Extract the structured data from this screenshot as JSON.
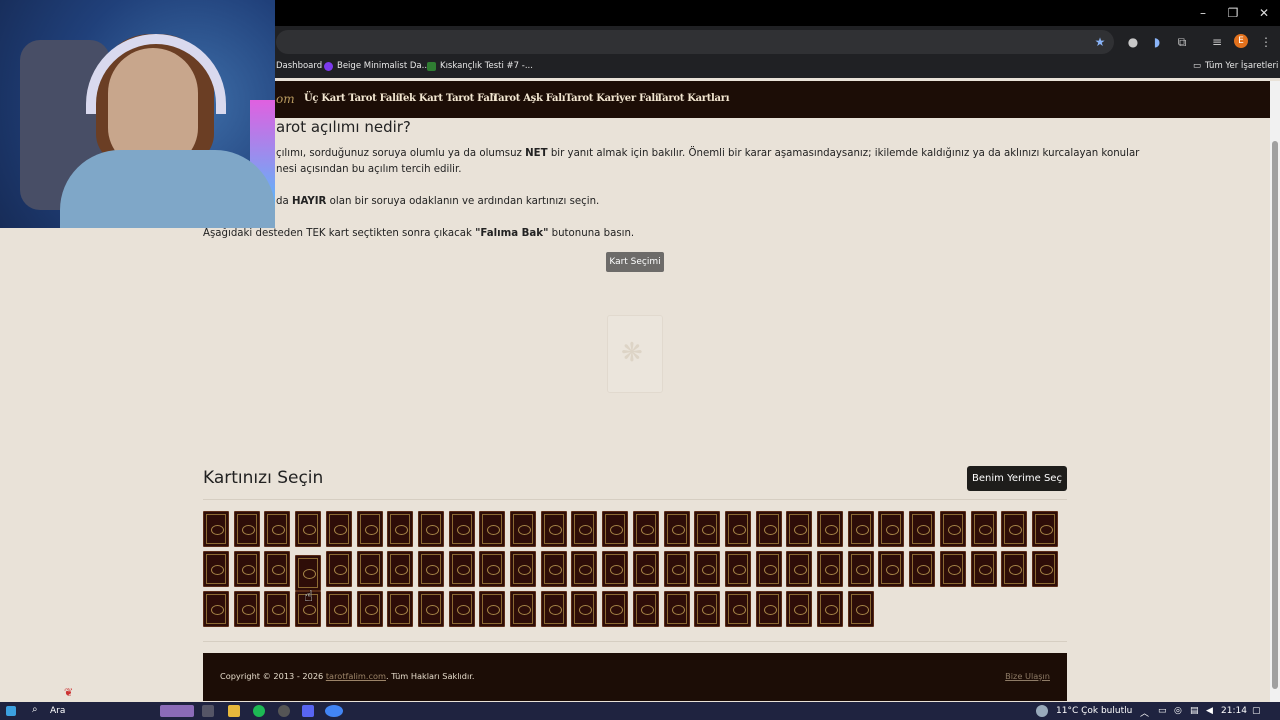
{
  "browser": {
    "window_controls": [
      "–",
      "❐",
      "✕"
    ],
    "bookmarks": [
      {
        "label": "Dashboard",
        "color": "#3b82f6"
      },
      {
        "label": "Beige Minimalist Da...",
        "color": "#7c3aed"
      },
      {
        "label": "Kıskançlık Testi #7 -...",
        "color": "#2f7d32"
      }
    ],
    "all_bookmarks": "Tüm Yer İşaretleri",
    "profile_initial": "E"
  },
  "site": {
    "logo_fragment": "om",
    "nav": [
      "Üç Kart Tarot Falı",
      "Tek Kart Tarot Falı",
      "Tarot Aşk Falı",
      "Tarot Kariyer Falı",
      "Tarot Kartları"
    ]
  },
  "main": {
    "heading": "arot açılımı nedir?",
    "para1_line1_a": "çılımı, sorduğunuz soruya olumlu ya da olumsuz ",
    "para1_bold": "NET",
    "para1_line1_b": " bir yanıt almak için bakılır. Önemli bir karar aşamasındaysanız; ikilemde kaldığınız ya da aklınızı kurcalayan konular",
    "para1_line2": "nesi açısından bu açılım tercih edilir.",
    "para2_a": " da ",
    "para2_bold": "HAYIR",
    "para2_b": " olan bir soruya odaklanın ve ardından kartınızı seçin.",
    "para3_a": "Aşağıdaki desteden TEK kart seçtikten sonra çıkacak ",
    "para3_bold": "\"Falıma Bak\"",
    "para3_b": " butonuna basın.",
    "select_button": "Kart Seçimi",
    "section_title": "Kartınızı Seçin",
    "choose_for_me": "Benim Yerime Seç",
    "deck": {
      "rows": [
        28,
        28,
        22
      ],
      "lifted": {
        "row": 1,
        "col": 3
      }
    }
  },
  "footer": {
    "copyright_a": "Copyright © 2013 - 2026 ",
    "site_link": "tarotfalim.com",
    "copyright_b": ". Tüm Hakları Saklıdır.",
    "contact": "Bize Ulaşın"
  },
  "taskbar": {
    "search": "Ara",
    "weather": "11°C  Çok bulutlu",
    "time": "21:14"
  },
  "colors": {
    "nav_bg": "#1c0d06",
    "page_bg": "#e9e2d8",
    "card_back": "#2e0d08"
  }
}
